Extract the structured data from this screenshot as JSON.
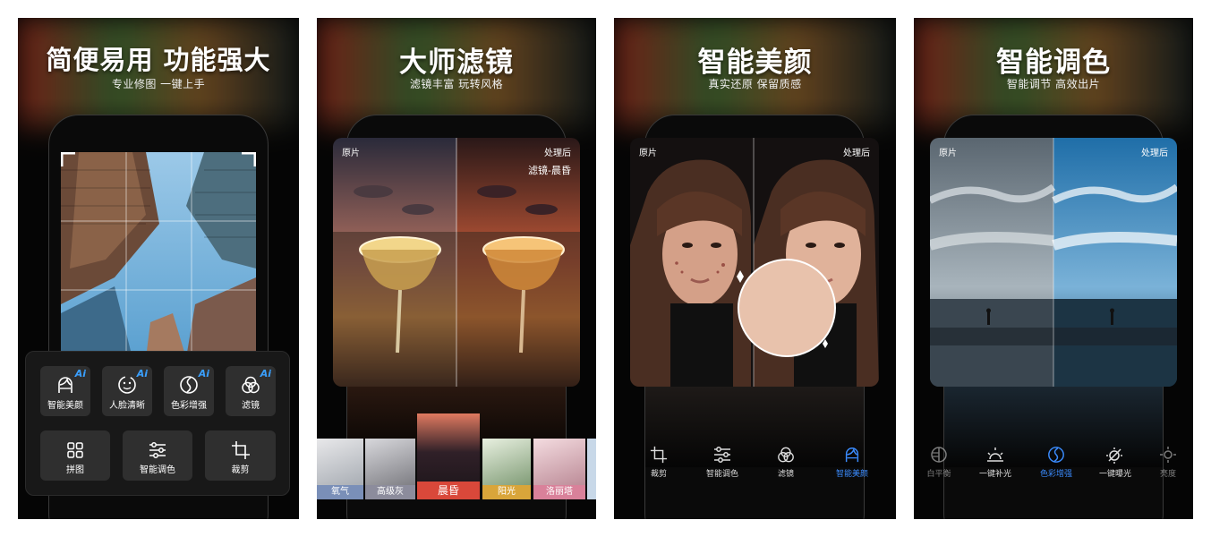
{
  "panels": [
    {
      "headline": "简便易用  功能强大",
      "subtitle": "专业修图   一键上手",
      "tools_row1": [
        {
          "label": "智能美颜",
          "icon": "face-icon",
          "ai": "Ai"
        },
        {
          "label": "人脸清晰",
          "icon": "face-clear-icon",
          "ai": "Ai"
        },
        {
          "label": "色彩增强",
          "icon": "color-icon",
          "ai": "Ai"
        },
        {
          "label": "滤镜",
          "icon": "filter-icon",
          "ai": "Ai"
        }
      ],
      "tools_row2": [
        {
          "label": "拼图",
          "icon": "grid-icon"
        },
        {
          "label": "智能调色",
          "icon": "sliders-icon"
        },
        {
          "label": "裁剪",
          "icon": "crop-icon"
        }
      ]
    },
    {
      "headline": "大师滤镜",
      "subtitle": "滤镜丰富   玩转风格",
      "before": "原片",
      "after": "处理后",
      "filter_name": "滤镜-晨昏",
      "filters": [
        {
          "label": "氧气",
          "color": "#7a8fb8"
        },
        {
          "label": "高级灰",
          "color": "#8c8c9c"
        },
        {
          "label": "晨昏",
          "color": "#d9483a"
        },
        {
          "label": "阳光",
          "color": "#d9a53a"
        },
        {
          "label": "洛丽塔",
          "color": "#d9819a"
        }
      ]
    },
    {
      "headline": "智能美颜",
      "subtitle": "真实还原   保留质感",
      "before": "原片",
      "after": "处理后",
      "toolbar": [
        {
          "label": "裁剪",
          "icon": "crop-icon",
          "active": false
        },
        {
          "label": "智能调色",
          "icon": "sliders-icon",
          "active": false
        },
        {
          "label": "滤镜",
          "icon": "filter-icon",
          "active": false
        },
        {
          "label": "智能美颜",
          "icon": "face-icon",
          "active": true
        }
      ],
      "accent": "#3b8cff"
    },
    {
      "headline": "智能调色",
      "subtitle": "智能调节   高效出片",
      "before": "原片",
      "after": "处理后",
      "toolbar": [
        {
          "label": "白平衡",
          "icon": "white-balance-icon",
          "active": false
        },
        {
          "label": "一键补光",
          "icon": "sunrise-icon",
          "active": false
        },
        {
          "label": "色彩增强",
          "icon": "color-icon",
          "active": true
        },
        {
          "label": "一键曝光",
          "icon": "exposure-icon",
          "active": false
        },
        {
          "label": "亮度",
          "icon": "brightness-icon",
          "active": false
        }
      ]
    }
  ]
}
